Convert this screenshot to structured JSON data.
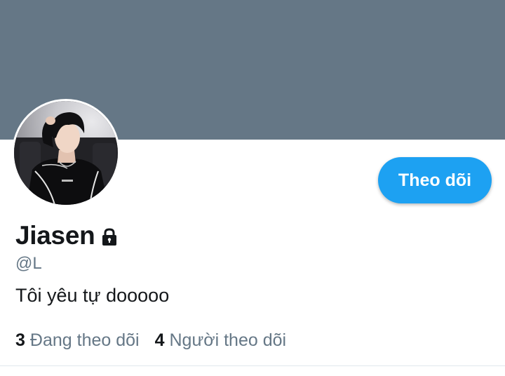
{
  "profile": {
    "display_name": "Jiasen",
    "handle": "@L",
    "bio": "Tôi yêu tự dooooo",
    "protected_icon": "lock-icon",
    "avatar": "profile-photo"
  },
  "actions": {
    "follow_label": "Theo dõi"
  },
  "stats": {
    "following_count": "3",
    "following_label": "Đang theo dõi",
    "followers_count": "4",
    "followers_label": "Người theo dõi"
  },
  "colors": {
    "banner": "#657786",
    "accent": "#1da1f2",
    "secondary_text": "#657786",
    "primary_text": "#14171a"
  }
}
